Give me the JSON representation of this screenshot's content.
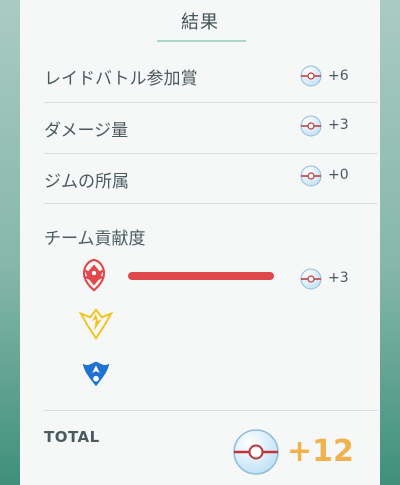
{
  "header": {
    "title": "結果"
  },
  "rows": [
    {
      "label": "レイドバトル参加賞",
      "value": "+6"
    },
    {
      "label": "ダメージ量",
      "value": "+3"
    },
    {
      "label": "ジムの所属",
      "value": "+0"
    }
  ],
  "team_contribution": {
    "label": "チーム貢献度",
    "valor_value": "+3",
    "teams": [
      "valor",
      "instinct",
      "mystic"
    ],
    "colors": {
      "valor": "#e0484b",
      "instinct": "#f2c318",
      "mystic": "#1f72d1"
    }
  },
  "total": {
    "label": "TOTAL",
    "value": "+12"
  },
  "icons": {
    "ball": "premier-ball-icon",
    "valor": "valor-team-icon",
    "instinct": "instinct-team-icon",
    "mystic": "mystic-team-icon"
  }
}
